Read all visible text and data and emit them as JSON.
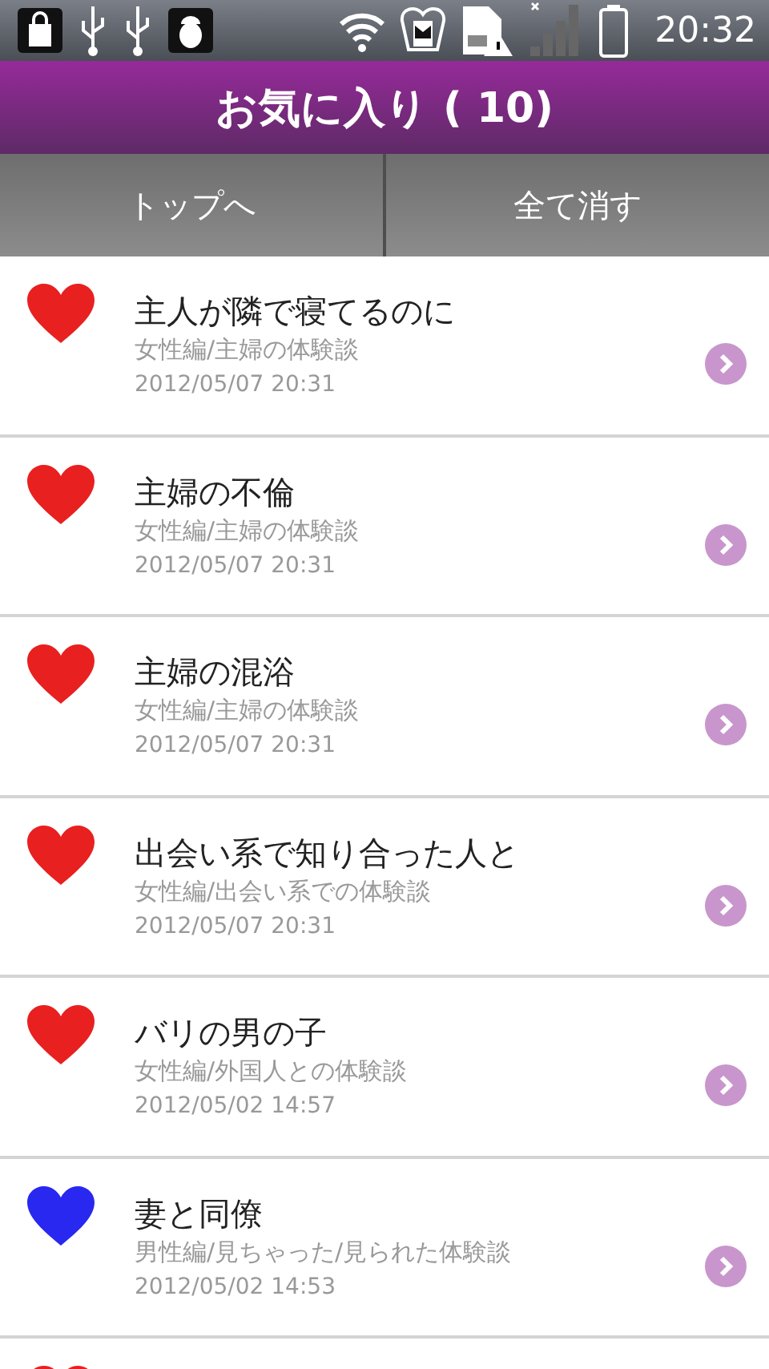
{
  "status_bar": {
    "time": "20:32"
  },
  "header": {
    "title": "お気に入り ( 10)"
  },
  "buttons": [
    {
      "label": "トップへ"
    },
    {
      "label": "全て消す"
    }
  ],
  "favorites": [
    {
      "color": "#e82020",
      "title": "主人が隣で寝てるのに",
      "category": "女性編/主婦の体験談",
      "date": "2012/05/07 20:31"
    },
    {
      "color": "#e82020",
      "title": "主婦の不倫",
      "category": "女性編/主婦の体験談",
      "date": "2012/05/07 20:31"
    },
    {
      "color": "#e82020",
      "title": "主婦の混浴",
      "category": "女性編/主婦の体験談",
      "date": "2012/05/07 20:31"
    },
    {
      "color": "#e82020",
      "title": "出会い系で知り合った人と",
      "category": "女性編/出会い系での体験談",
      "date": "2012/05/07 20:31"
    },
    {
      "color": "#e82020",
      "title": "バリの男の子",
      "category": "女性編/外国人との体験談",
      "date": "2012/05/02 14:57"
    },
    {
      "color": "#2828f0",
      "title": "妻と同僚",
      "category": "男性編/見ちゃった/見られた体験談",
      "date": "2012/05/02 14:53"
    },
    {
      "color": "#e82020"
    }
  ]
}
